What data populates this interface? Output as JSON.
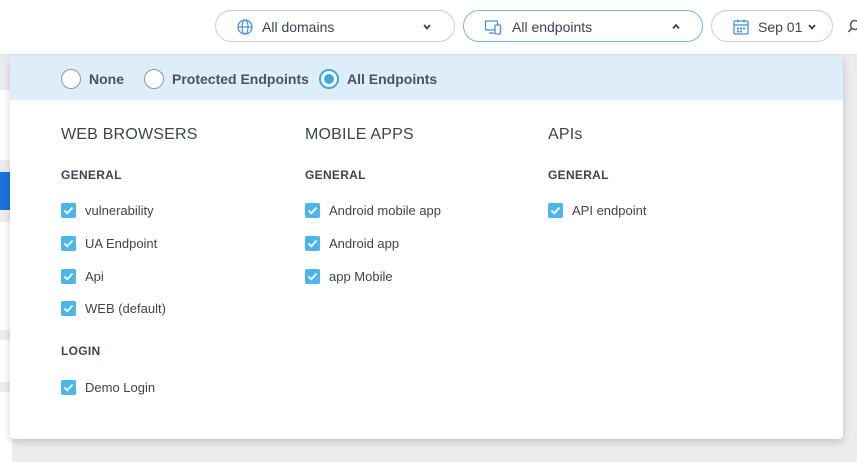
{
  "topbar": {
    "domains": {
      "label": "All domains",
      "icon": "globe-icon"
    },
    "endpoints": {
      "label": "All endpoints",
      "icon": "devices-icon",
      "expanded": true
    },
    "date": {
      "label": "Sep 01",
      "icon": "calendar-icon"
    }
  },
  "mode": {
    "options": [
      {
        "label": "None",
        "checked": false
      },
      {
        "label": "Protected Endpoints",
        "checked": false
      },
      {
        "label": "All Endpoints",
        "checked": true
      }
    ]
  },
  "columns": {
    "web": {
      "title": "WEB BROWSERS",
      "groups": [
        {
          "title": "GENERAL",
          "items": [
            "vulnerability",
            "UA Endpoint",
            "Api",
            "WEB (default)"
          ]
        },
        {
          "title": "LOGIN",
          "items": [
            "Demo Login"
          ]
        }
      ]
    },
    "mobile": {
      "title": "MOBILE APPS",
      "groups": [
        {
          "title": "GENERAL",
          "items": [
            "Android mobile app",
            "Android app",
            "app Mobile"
          ]
        }
      ]
    },
    "api": {
      "title": "APIs",
      "groups": [
        {
          "title": "GENERAL",
          "items": [
            "API endpoint"
          ]
        }
      ]
    }
  },
  "colors": {
    "accent": "#3ea8e0",
    "checkbox": "#4db6e8",
    "mode_bar": "#ddeefa"
  }
}
